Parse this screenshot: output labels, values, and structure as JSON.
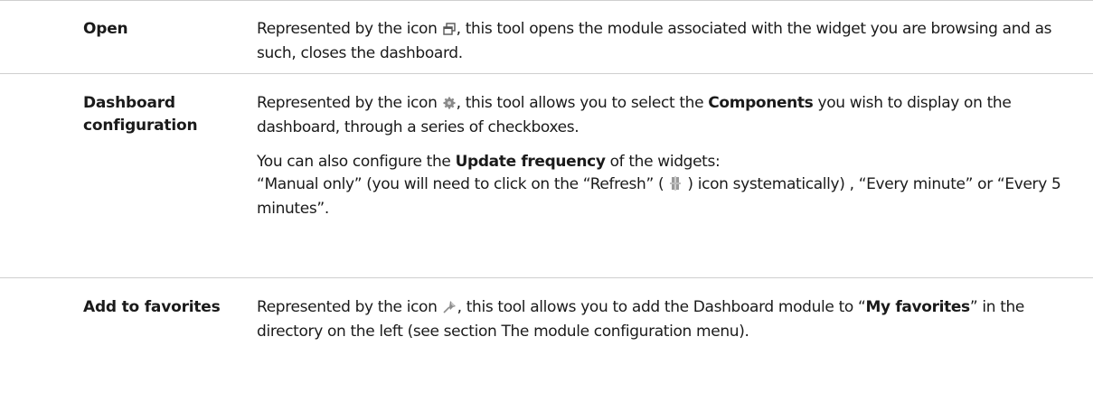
{
  "rows": [
    {
      "term": "Open",
      "desc": {
        "before_icon": "Represented by the icon",
        "icon": "window-restore-icon",
        "after_icon": ", this tool opens the module associated with the widget you are browsing and as such, closes the dashboard."
      }
    },
    {
      "term": "Dashboard configuration",
      "desc": {
        "before_icon": "Represented by the icon",
        "icon": "gear-icon",
        "mid": ", this tool allows you to select the",
        "bold1": "Components",
        "after_bold1": "you wish to display on the dashboard, through a series of checkboxes.",
        "p2_before": "You can also configure the",
        "p2_bold": "Update frequency",
        "p2_after": "of the widgets:",
        "p3_before_icon": "“Manual only” (you will need to click on the “Refresh” (",
        "p3_icon": "refresh-icon",
        "p3_after_icon": ") icon systematically) , “Every minute” or “Every 5 minutes”."
      }
    },
    {
      "term": "Add to favorites",
      "desc": {
        "before_icon": "Represented by the icon",
        "icon": "pin-icon",
        "mid": ", this tool allows you to add the Dashboard module to",
        "quote_open": "“",
        "bold1": "My favorites",
        "after_bold1": "” in the directory on the left (see section The module configuration menu)."
      }
    }
  ],
  "colors": {
    "divider": "#cfcfcf",
    "text": "#1a1a1a"
  }
}
